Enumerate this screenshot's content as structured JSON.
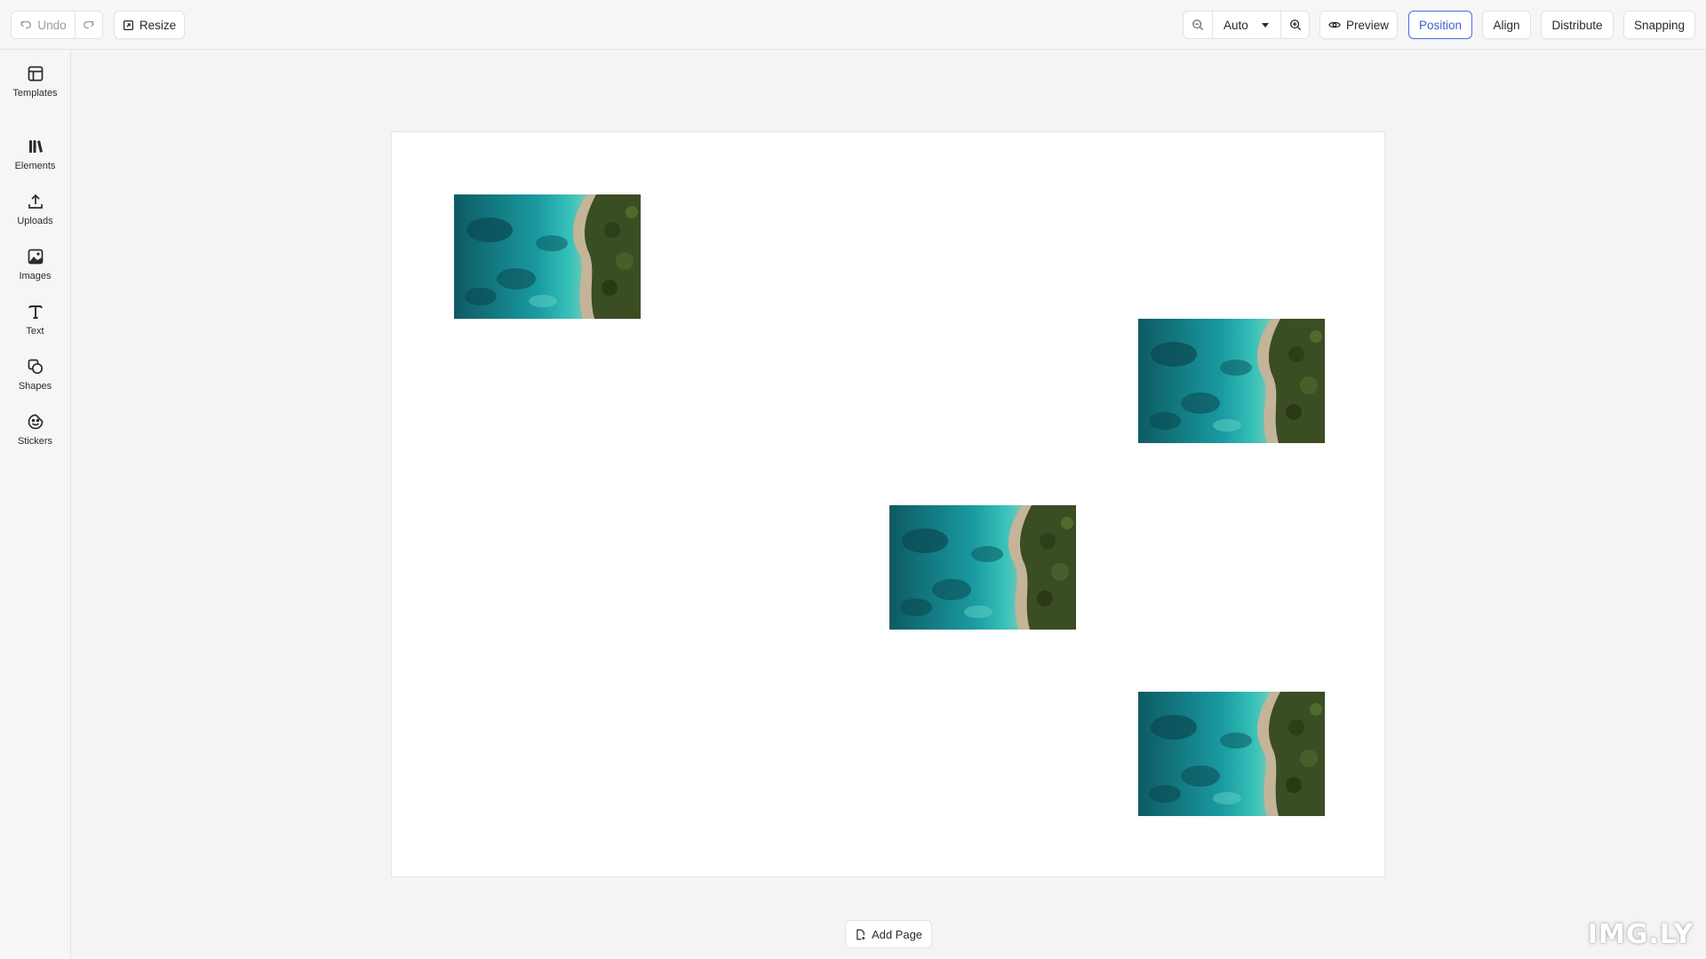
{
  "toolbar": {
    "undo_label": "Undo",
    "resize_label": "Resize",
    "zoom_value": "Auto",
    "preview_label": "Preview",
    "position_label": "Position",
    "align_label": "Align",
    "distribute_label": "Distribute",
    "snapping_label": "Snapping",
    "accent_color": "#4a6ee0"
  },
  "sidebar": {
    "items": [
      {
        "label": "Templates",
        "icon": "layout-icon"
      },
      {
        "label": "Elements",
        "icon": "library-icon"
      },
      {
        "label": "Uploads",
        "icon": "upload-icon"
      },
      {
        "label": "Images",
        "icon": "image-icon"
      },
      {
        "label": "Text",
        "icon": "text-icon"
      },
      {
        "label": "Shapes",
        "icon": "shapes-icon"
      },
      {
        "label": "Stickers",
        "icon": "sticker-icon"
      }
    ]
  },
  "canvas": {
    "add_page_label": "Add Page",
    "photo_description": "aerial coastline turquoise water",
    "photo_count": 4
  },
  "watermark": "IMG.LY"
}
